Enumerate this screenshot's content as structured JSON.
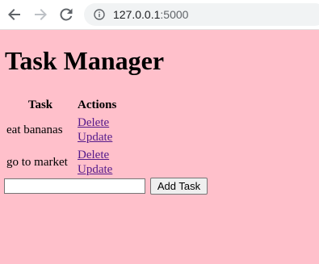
{
  "browser": {
    "url_host": "127.0.0.1",
    "url_port": ":5000",
    "icons": [
      "back-arrow-icon",
      "forward-arrow-icon",
      "reload-icon",
      "info-icon"
    ]
  },
  "page": {
    "title": "Task Manager",
    "table": {
      "headers": {
        "task": "Task",
        "actions": "Actions"
      },
      "rows": [
        {
          "task": "eat bananas",
          "delete": "Delete",
          "update": "Update"
        },
        {
          "task": "go to market",
          "delete": "Delete",
          "update": "Update"
        }
      ]
    },
    "form": {
      "input_value": "",
      "button_label": "Add Task"
    },
    "colors": {
      "background": "#ffc0cb",
      "link": "#551a8b"
    }
  }
}
